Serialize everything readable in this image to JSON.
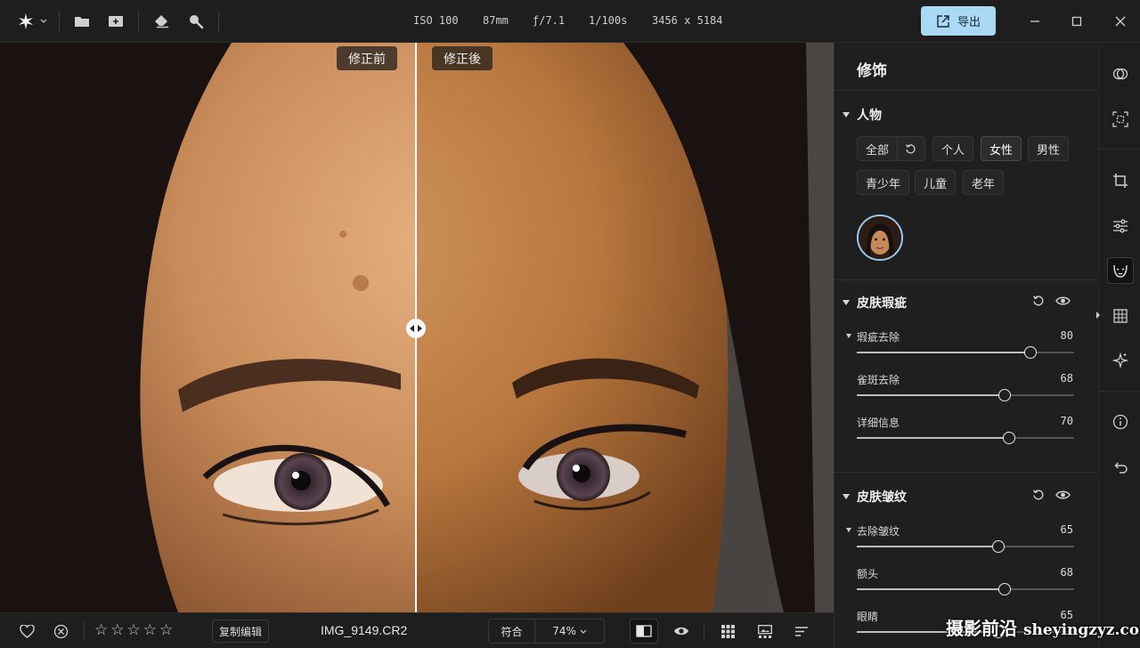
{
  "toolbar": {
    "icons": [
      "app-logo-icon",
      "folder-icon",
      "add-image-icon",
      "eraser-icon",
      "search-icon"
    ],
    "meta": {
      "iso": "ISO 100",
      "focal": "87mm",
      "aperture": "ƒ/7.1",
      "shutter": "1/100s",
      "dimensions": "3456 x 5184"
    },
    "export_label": "导出"
  },
  "photo": {
    "before_label": "修正前",
    "after_label": "修正後"
  },
  "panel": {
    "title": "修饰",
    "people": {
      "heading": "人物",
      "chips": [
        "全部",
        "个人",
        "女性",
        "男性",
        "青少年",
        "儿童",
        "老年"
      ],
      "active_chip": "女性"
    },
    "skin_blemish": {
      "heading": "皮肤瑕疵",
      "sliders": [
        {
          "label": "瑕疵去除",
          "value": "80",
          "level": 0.8,
          "sub": true
        },
        {
          "label": "雀斑去除",
          "value": "68",
          "level": 0.68,
          "sub": false
        },
        {
          "label": "详细信息",
          "value": "70",
          "level": 0.7,
          "sub": false
        }
      ]
    },
    "skin_wrinkle": {
      "heading": "皮肤皱纹",
      "sliders": [
        {
          "label": "去除皱纹",
          "value": "65",
          "level": 0.65,
          "sub": true
        },
        {
          "label": "额头",
          "value": "68",
          "level": 0.68,
          "sub": false
        },
        {
          "label": "眼睛",
          "value": "65",
          "level": 0.65,
          "sub": false
        }
      ]
    }
  },
  "bottom": {
    "copy_edit_label": "复制编辑",
    "filename": "IMG_9149.CR2",
    "fit_label": "符合",
    "zoom_label": "74%",
    "rating": 0
  },
  "watermark": {
    "text": "摄影前沿",
    "url": "sheyingzyz.com"
  }
}
